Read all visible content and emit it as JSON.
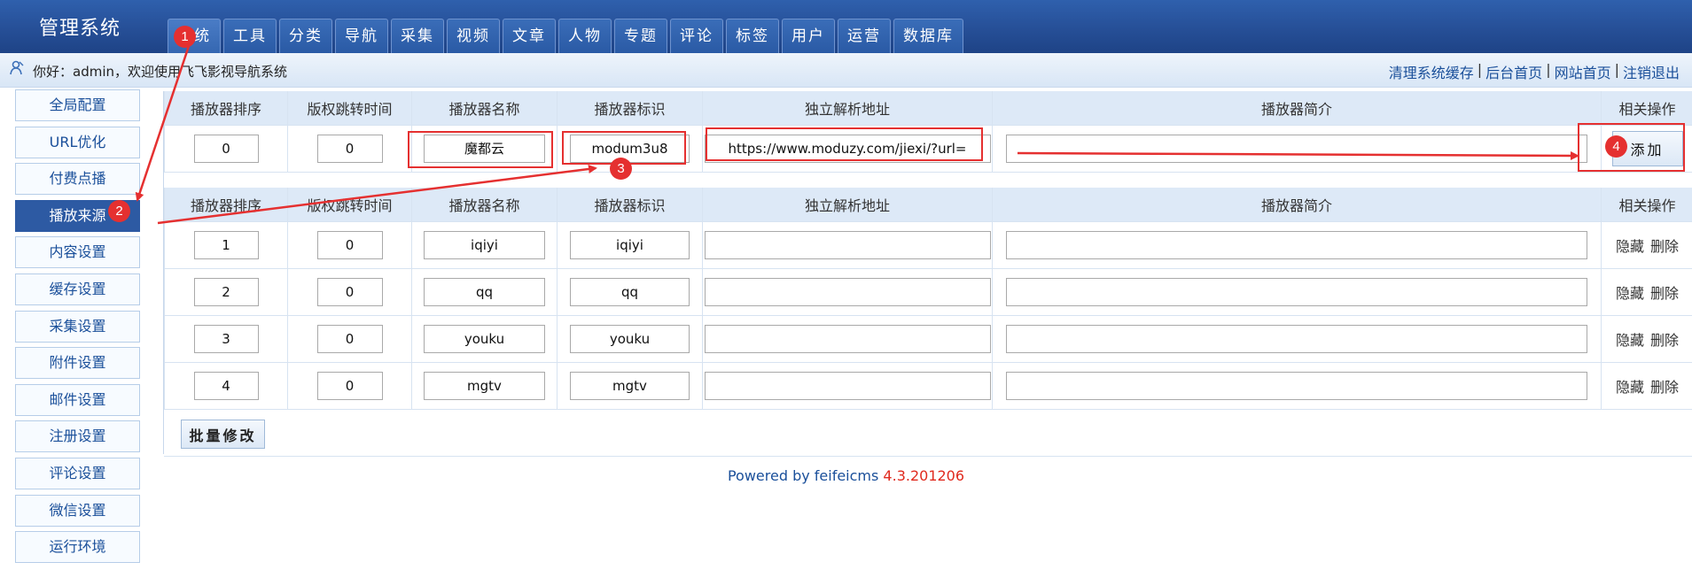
{
  "header": {
    "logo": "管理系统",
    "tabs": [
      "系统",
      "工具",
      "分类",
      "导航",
      "采集",
      "视频",
      "文章",
      "人物",
      "专题",
      "评论",
      "标签",
      "用户",
      "运营",
      "数据库"
    ]
  },
  "welcome": {
    "text": "你好：admin，欢迎使用飞飞影视导航系统",
    "links": [
      "清理系统缓存",
      "后台首页",
      "网站首页",
      "注销退出"
    ]
  },
  "sidebar": {
    "items": [
      "全局配置",
      "URL优化",
      "付费点播",
      "播放来源",
      "内容设置",
      "缓存设置",
      "采集设置",
      "附件设置",
      "邮件设置",
      "注册设置",
      "评论设置",
      "微信设置",
      "运行环境"
    ],
    "active_index": 3
  },
  "table": {
    "headers": [
      "播放器排序",
      "版权跳转时间",
      "播放器名称",
      "播放器标识",
      "独立解析地址",
      "播放器简介",
      "相关操作"
    ]
  },
  "add_row": {
    "sort": "0",
    "time": "0",
    "name": "魔都云",
    "id": "modum3u8",
    "url": "https://www.moduzy.com/jiexi/?url=",
    "desc": "",
    "button": "添加"
  },
  "rows": [
    {
      "sort": "1",
      "time": "0",
      "name": "iqiyi",
      "id": "iqiyi",
      "url": "",
      "desc": "",
      "hide": "隐藏",
      "del": "删除"
    },
    {
      "sort": "2",
      "time": "0",
      "name": "qq",
      "id": "qq",
      "url": "",
      "desc": "",
      "hide": "隐藏",
      "del": "删除"
    },
    {
      "sort": "3",
      "time": "0",
      "name": "youku",
      "id": "youku",
      "url": "",
      "desc": "",
      "hide": "隐藏",
      "del": "删除"
    },
    {
      "sort": "4",
      "time": "0",
      "name": "mgtv",
      "id": "mgtv",
      "url": "",
      "desc": "",
      "hide": "隐藏",
      "del": "删除"
    }
  ],
  "batch_button": "批量修改",
  "footer": {
    "text": "Powered by feifeicms ",
    "version": "4.3.201206"
  },
  "annotations": {
    "badges": [
      "1",
      "2",
      "3",
      "4"
    ],
    "color": "#e53030"
  }
}
